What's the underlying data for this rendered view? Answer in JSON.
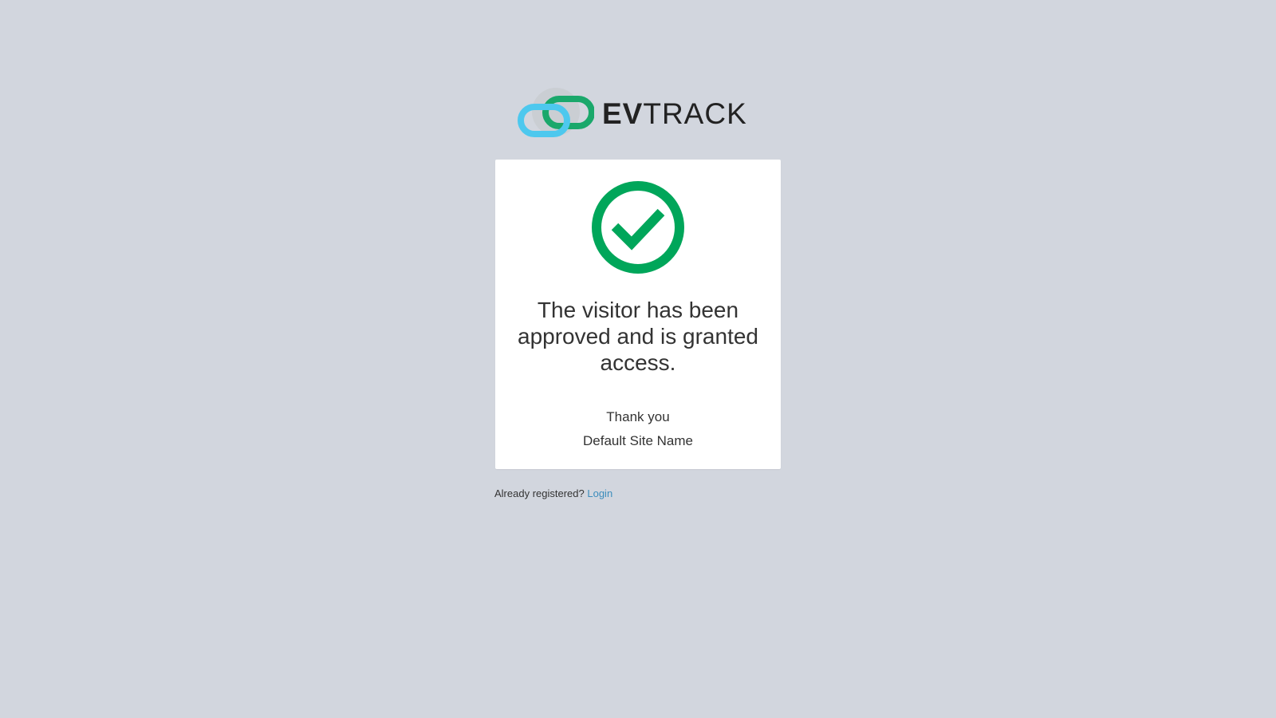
{
  "brand": {
    "name_bold": "EV",
    "name_thin": "TRACK",
    "logo_icon": "chain-link-logo-icon",
    "colors": {
      "green": "#1aa86b",
      "cyan": "#4dc8ee",
      "gray": "#c9ccd1",
      "text": "#222222"
    }
  },
  "card": {
    "status_icon": "check-circle-icon",
    "status_color": "#00a65a",
    "headline": "The visitor has been approved and is granted access.",
    "thanks": "Thank you",
    "site_name": "Default Site Name"
  },
  "footer": {
    "prompt": "Already registered?",
    "login_label": "Login",
    "link_color": "#3c8dbc"
  },
  "page": {
    "background": "#d2d6de"
  }
}
